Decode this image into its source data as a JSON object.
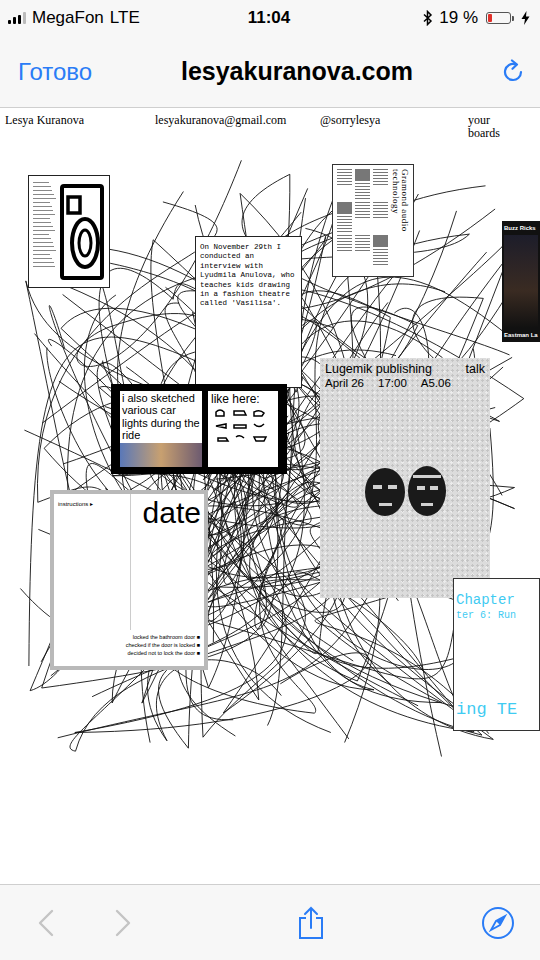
{
  "status_bar": {
    "carrier": "MegaFon",
    "network": "LTE",
    "time": "11:04",
    "battery": "19 %",
    "battery_level": 0.19,
    "signal_level": 0.75,
    "charging": true
  },
  "nav": {
    "done": "Готово",
    "url": "lesyakuranova.com"
  },
  "page": {
    "header": [
      "Lesya Kuranova",
      "lesyakuranova@gmail.com",
      "@sorrylesya",
      "your boards"
    ],
    "cards": [
      {
        "kind": "document"
      },
      {
        "kind": "note",
        "text": "On November 29th I conducted an interview with Lyudmila Anulova, who teaches kids drawing in a fashion theatre called 'Vasilisa'."
      },
      {
        "kind": "newspaper",
        "text": "Gramond audio technology"
      },
      {
        "kind": "dark",
        "lines": [
          "Buzz Ricks",
          "Eastman La"
        ]
      },
      {
        "kind": "sketch",
        "text": "i also sketched various car lights during the ride",
        "caption": "like here:"
      },
      {
        "kind": "poster",
        "title": "Lugemik publishing",
        "tag": "talk",
        "details": [
          "April 26",
          "17:00",
          "A5.06"
        ]
      },
      {
        "kind": "zine",
        "small": "instructions ▸",
        "title": "date",
        "lines": [
          "locked the bathroom door ■",
          "checked if the door is locked ■",
          "decided not to lock the door ■"
        ]
      },
      {
        "kind": "pixel",
        "lines": [
          "Chapter",
          "ter 6: Run",
          "ing TE"
        ]
      }
    ]
  },
  "toolbar": {
    "back": {
      "disabled": true
    },
    "forward": {
      "disabled": true
    }
  }
}
